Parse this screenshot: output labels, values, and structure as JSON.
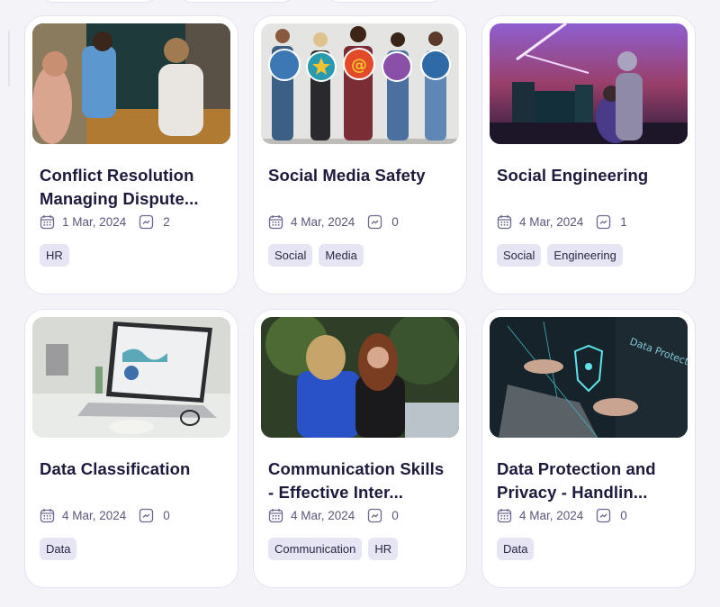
{
  "cards": [
    {
      "title": "Conflict Resolution Managing Dispute...",
      "image": "office-meeting-argument-photo",
      "date": "1 Mar, 2024",
      "views": "2",
      "tags": [
        "HR"
      ]
    },
    {
      "title": "Social Media Safety",
      "image": "people-holding-social-icons-photo",
      "date": "4 Mar, 2024",
      "views": "0",
      "tags": [
        "Social",
        "Media"
      ]
    },
    {
      "title": "Social Engineering",
      "image": "hackers-at-computers-photo",
      "date": "4 Mar, 2024",
      "views": "1",
      "tags": [
        "Social",
        "Engineering"
      ]
    },
    {
      "title": "Data Classification",
      "image": "laptop-with-charts-photo",
      "date": "4 Mar, 2024",
      "views": "0",
      "tags": [
        "Data"
      ]
    },
    {
      "title": "Communication Skills - Effective Inter...",
      "image": "two-women-talking-outdoors-photo",
      "date": "4 Mar, 2024",
      "views": "0",
      "tags": [
        "Communication",
        "HR"
      ]
    },
    {
      "title": "Data Protection and Privacy - Handlin...",
      "image": "data-protection-laptop-photo",
      "date": "4 Mar, 2024",
      "views": "0",
      "tags": [
        "Data"
      ]
    }
  ],
  "icons": {
    "date": "calendar-icon",
    "views": "trending-icon"
  }
}
